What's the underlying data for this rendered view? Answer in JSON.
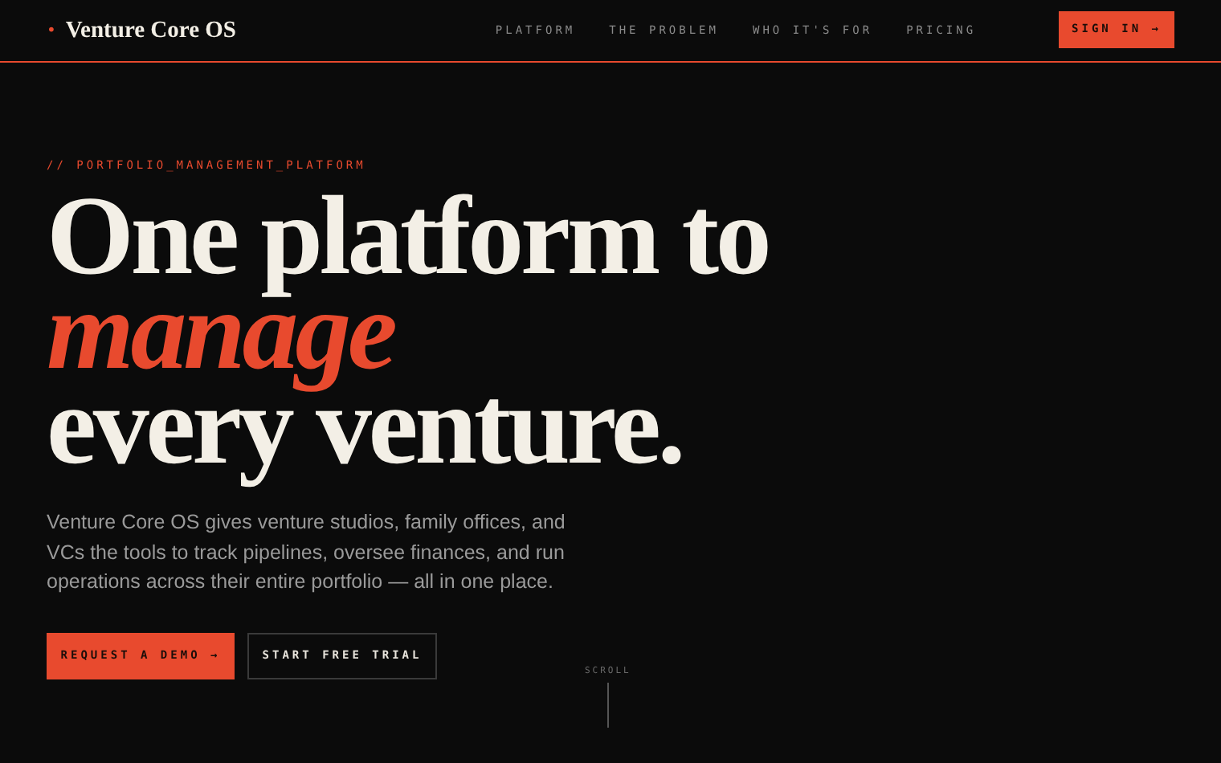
{
  "brand": {
    "dot": "•",
    "name": "Venture Core OS"
  },
  "nav": [
    "PLATFORM",
    "THE PROBLEM",
    "WHO IT'S FOR",
    "PRICING"
  ],
  "sign_in": "SIGN IN →",
  "eyebrow": "// PORTFOLIO_MANAGEMENT_PLATFORM",
  "headline": [
    {
      "text": "One platform to",
      "kind": "plain"
    },
    {
      "text": "manage",
      "kind": "accent"
    },
    {
      "text": "every venture.",
      "kind": "plain"
    }
  ],
  "description": "Venture Core OS gives venture studios, family offices, and VCs the tools to track pipelines, oversee finances, and run operations across their entire portfolio — all in one place.",
  "actions": [
    {
      "label": "REQUEST A DEMO →",
      "kind": "primary"
    },
    {
      "label": "START FREE TRIAL",
      "kind": "outline"
    }
  ],
  "scroll": "SCROLL"
}
